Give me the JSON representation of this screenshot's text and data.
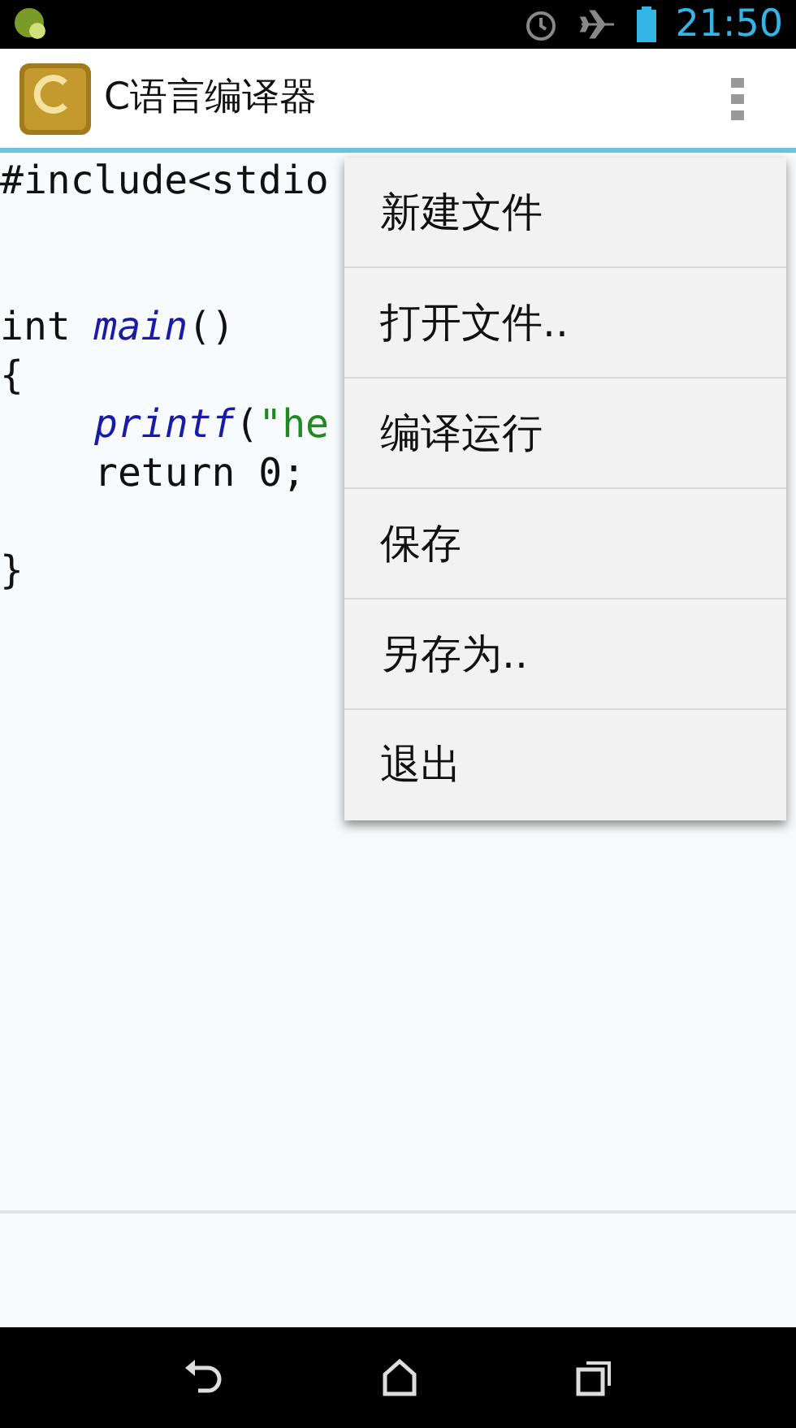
{
  "status_bar": {
    "time": "21:50"
  },
  "action_bar": {
    "title": "C语言编译器"
  },
  "code": {
    "lines": [
      {
        "kind": "code",
        "indented": false,
        "tokens": [
          {
            "kind": "plain",
            "text": "#include<stdio"
          }
        ]
      },
      {
        "kind": "blank"
      },
      {
        "kind": "blank"
      },
      {
        "kind": "code",
        "indented": false,
        "tokens": [
          {
            "kind": "plain",
            "text": "int "
          },
          {
            "kind": "func",
            "text": "main"
          },
          {
            "kind": "plain",
            "text": "()"
          }
        ]
      },
      {
        "kind": "code",
        "indented": false,
        "tokens": [
          {
            "kind": "plain",
            "text": "{"
          }
        ]
      },
      {
        "kind": "code",
        "indented": true,
        "tokens": [
          {
            "kind": "func",
            "text": "printf"
          },
          {
            "kind": "plain",
            "text": "("
          },
          {
            "kind": "string",
            "text": "\"he"
          }
        ]
      },
      {
        "kind": "code",
        "indented": true,
        "tokens": [
          {
            "kind": "plain",
            "text": "return 0;"
          }
        ]
      },
      {
        "kind": "blank"
      },
      {
        "kind": "code",
        "indented": false,
        "tokens": [
          {
            "kind": "plain",
            "text": "}"
          }
        ]
      }
    ]
  },
  "menu": {
    "items": [
      {
        "label": "新建文件"
      },
      {
        "label": "打开文件.."
      },
      {
        "label": "编译运行"
      },
      {
        "label": "保存"
      },
      {
        "label": "另存为.."
      },
      {
        "label": "退出"
      }
    ]
  }
}
